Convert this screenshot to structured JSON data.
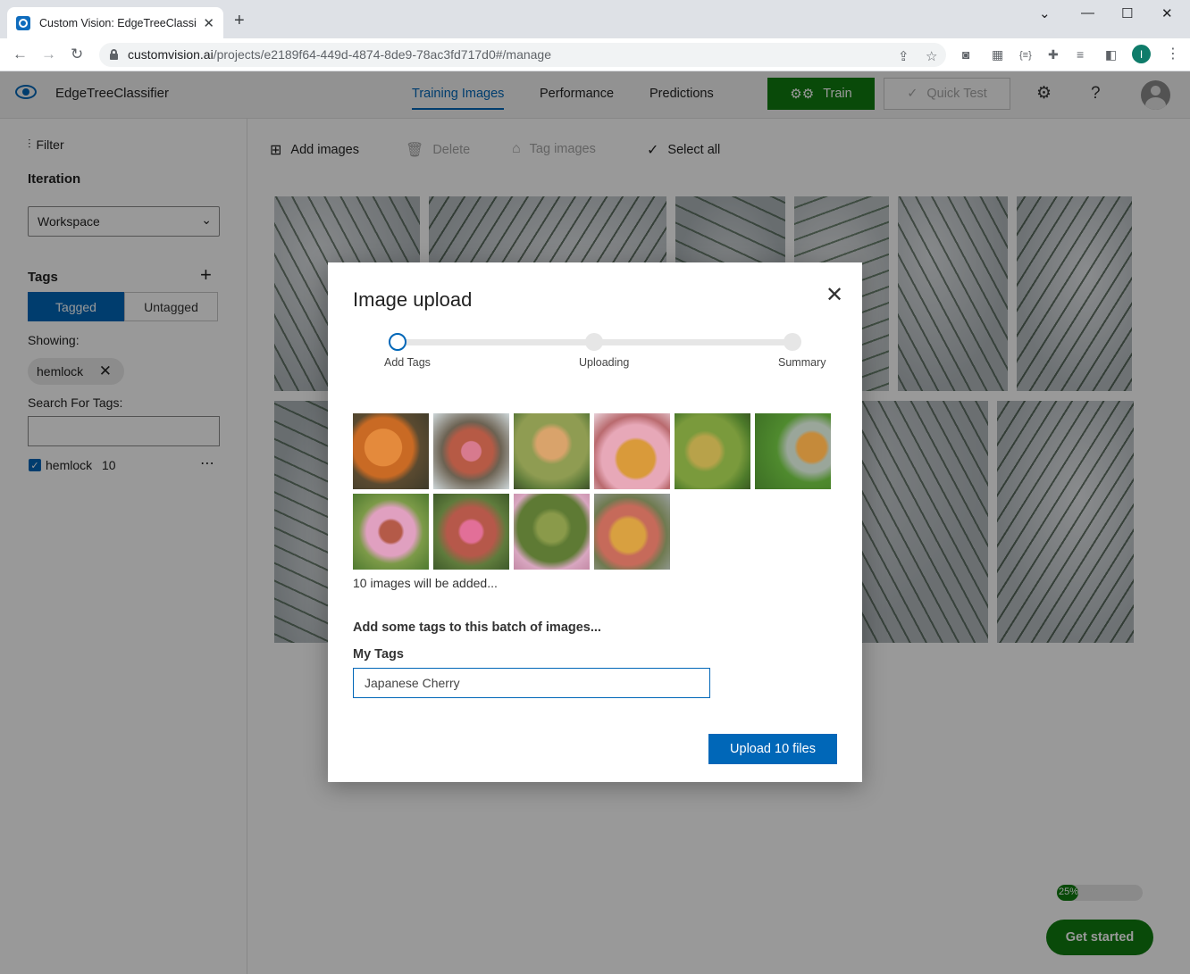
{
  "browser": {
    "tab_title": "Custom Vision: EdgeTreeClassifier",
    "url_host": "customvision.ai",
    "url_path": "/projects/e2189f64-449d-4874-8de9-78ac3fd717d0#/manage"
  },
  "header": {
    "project_name": "EdgeTreeClassifier",
    "nav": [
      "Training Images",
      "Performance",
      "Predictions"
    ],
    "train_label": "Train",
    "quick_test_label": "Quick Test"
  },
  "sidebar": {
    "filter_label": "Filter",
    "iteration_heading": "Iteration",
    "iteration_value": "Workspace",
    "tags_heading": "Tags",
    "tagged_label": "Tagged",
    "untagged_label": "Untagged",
    "showing_label": "Showing:",
    "showing_chip": "hemlock",
    "search_label": "Search For Tags:",
    "tag_item": {
      "name": "hemlock",
      "count": "10"
    }
  },
  "toolbar": {
    "add_images": "Add images",
    "delete": "Delete",
    "tag_images": "Tag images",
    "select_all": "Select all"
  },
  "progress": {
    "value": 0.25,
    "label": "25%"
  },
  "get_started_label": "Get started",
  "modal": {
    "title": "Image upload",
    "steps": [
      "Add Tags",
      "Uploading",
      "Summary"
    ],
    "current_step": 0,
    "count_text": "10 images will be added...",
    "tags_prompt": "Add some tags to this batch of images...",
    "my_tags_label": "My Tags",
    "tag_input_value": "Japanese Cherry",
    "upload_button": "Upload 10 files"
  },
  "colors": {
    "accent": "#0067b8",
    "train_green": "#107c10"
  }
}
